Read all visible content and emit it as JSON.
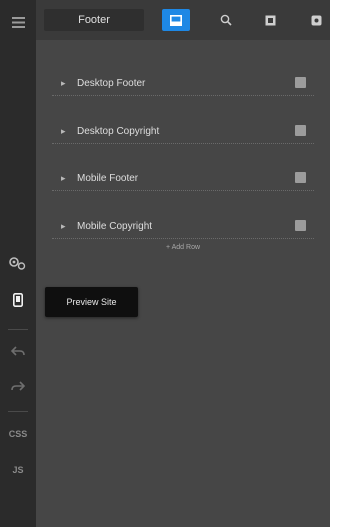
{
  "topbar": {
    "title": "Footer",
    "tools": [
      {
        "icon": "save-icon",
        "active": true
      },
      {
        "icon": "search-icon",
        "active": false
      },
      {
        "icon": "square-icon",
        "active": false
      },
      {
        "icon": "gear-icon",
        "active": false
      }
    ]
  },
  "sidebar": {
    "items": [
      {
        "icon": "menu-icon"
      },
      {
        "icon": "settings-icon"
      },
      {
        "icon": "preview-icon",
        "active": true
      },
      {
        "icon": "undo-icon"
      },
      {
        "icon": "redo-icon"
      },
      {
        "label": "CSS"
      },
      {
        "label": "JS"
      }
    ]
  },
  "sections": [
    {
      "label": "Desktop Footer"
    },
    {
      "label": "Desktop Copyright"
    },
    {
      "label": "Mobile Footer"
    },
    {
      "label": "Mobile Copyright"
    }
  ],
  "add_section": {
    "label": "+ Add Row"
  },
  "tooltip": {
    "text": "Preview Site"
  }
}
